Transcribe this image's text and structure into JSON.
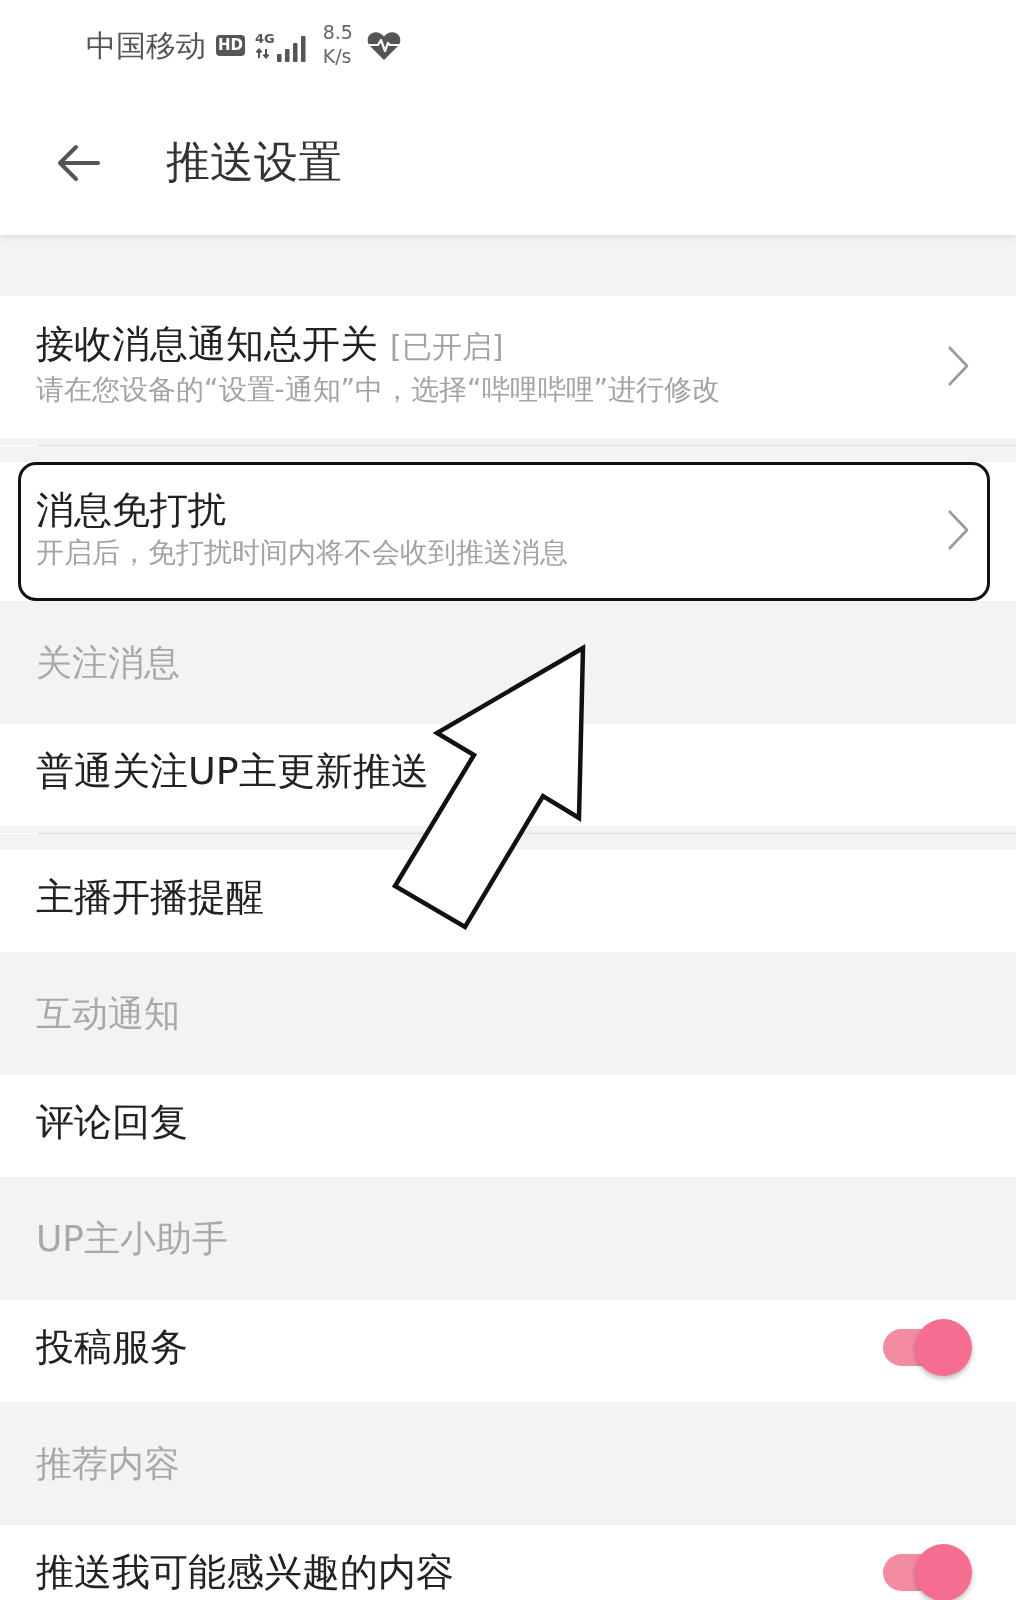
{
  "status_bar": {
    "carrier": "中国移动",
    "hd_badge": "HD",
    "network": "4G",
    "speed_value": "8.5",
    "speed_unit": "K/s"
  },
  "header": {
    "title": "推送设置"
  },
  "sections": [
    {
      "rows": [
        {
          "kind": "link",
          "title": "接收消息通知总开关",
          "status": "[已开启]",
          "subtitle": "请在您设备的“设置-通知”中，选择“哔哩哔哩”进行修改",
          "highlighted": false
        },
        {
          "kind": "link",
          "title": "消息免打扰",
          "subtitle": "开启后，免打扰时间内将不会收到推送消息",
          "highlighted": true
        }
      ]
    },
    {
      "title": "关注消息",
      "rows": [
        {
          "kind": "plain",
          "title": "普通关注UP主更新推送",
          "highlighted": false
        },
        {
          "kind": "plain",
          "title": "主播开播提醒",
          "highlighted": false
        }
      ]
    },
    {
      "title": "互动通知",
      "rows": [
        {
          "kind": "plain",
          "title": "评论回复",
          "highlighted": false
        }
      ]
    },
    {
      "title": "UP主小助手",
      "rows": [
        {
          "kind": "toggle",
          "title": "投稿服务",
          "on": true,
          "highlighted": false
        }
      ]
    },
    {
      "title": "推荐内容",
      "rows": [
        {
          "kind": "toggle",
          "title": "推送我可能感兴趣的内容",
          "on": true,
          "highlighted": false
        }
      ]
    }
  ],
  "annotations": [
    {
      "kind": "arrow"
    }
  ]
}
